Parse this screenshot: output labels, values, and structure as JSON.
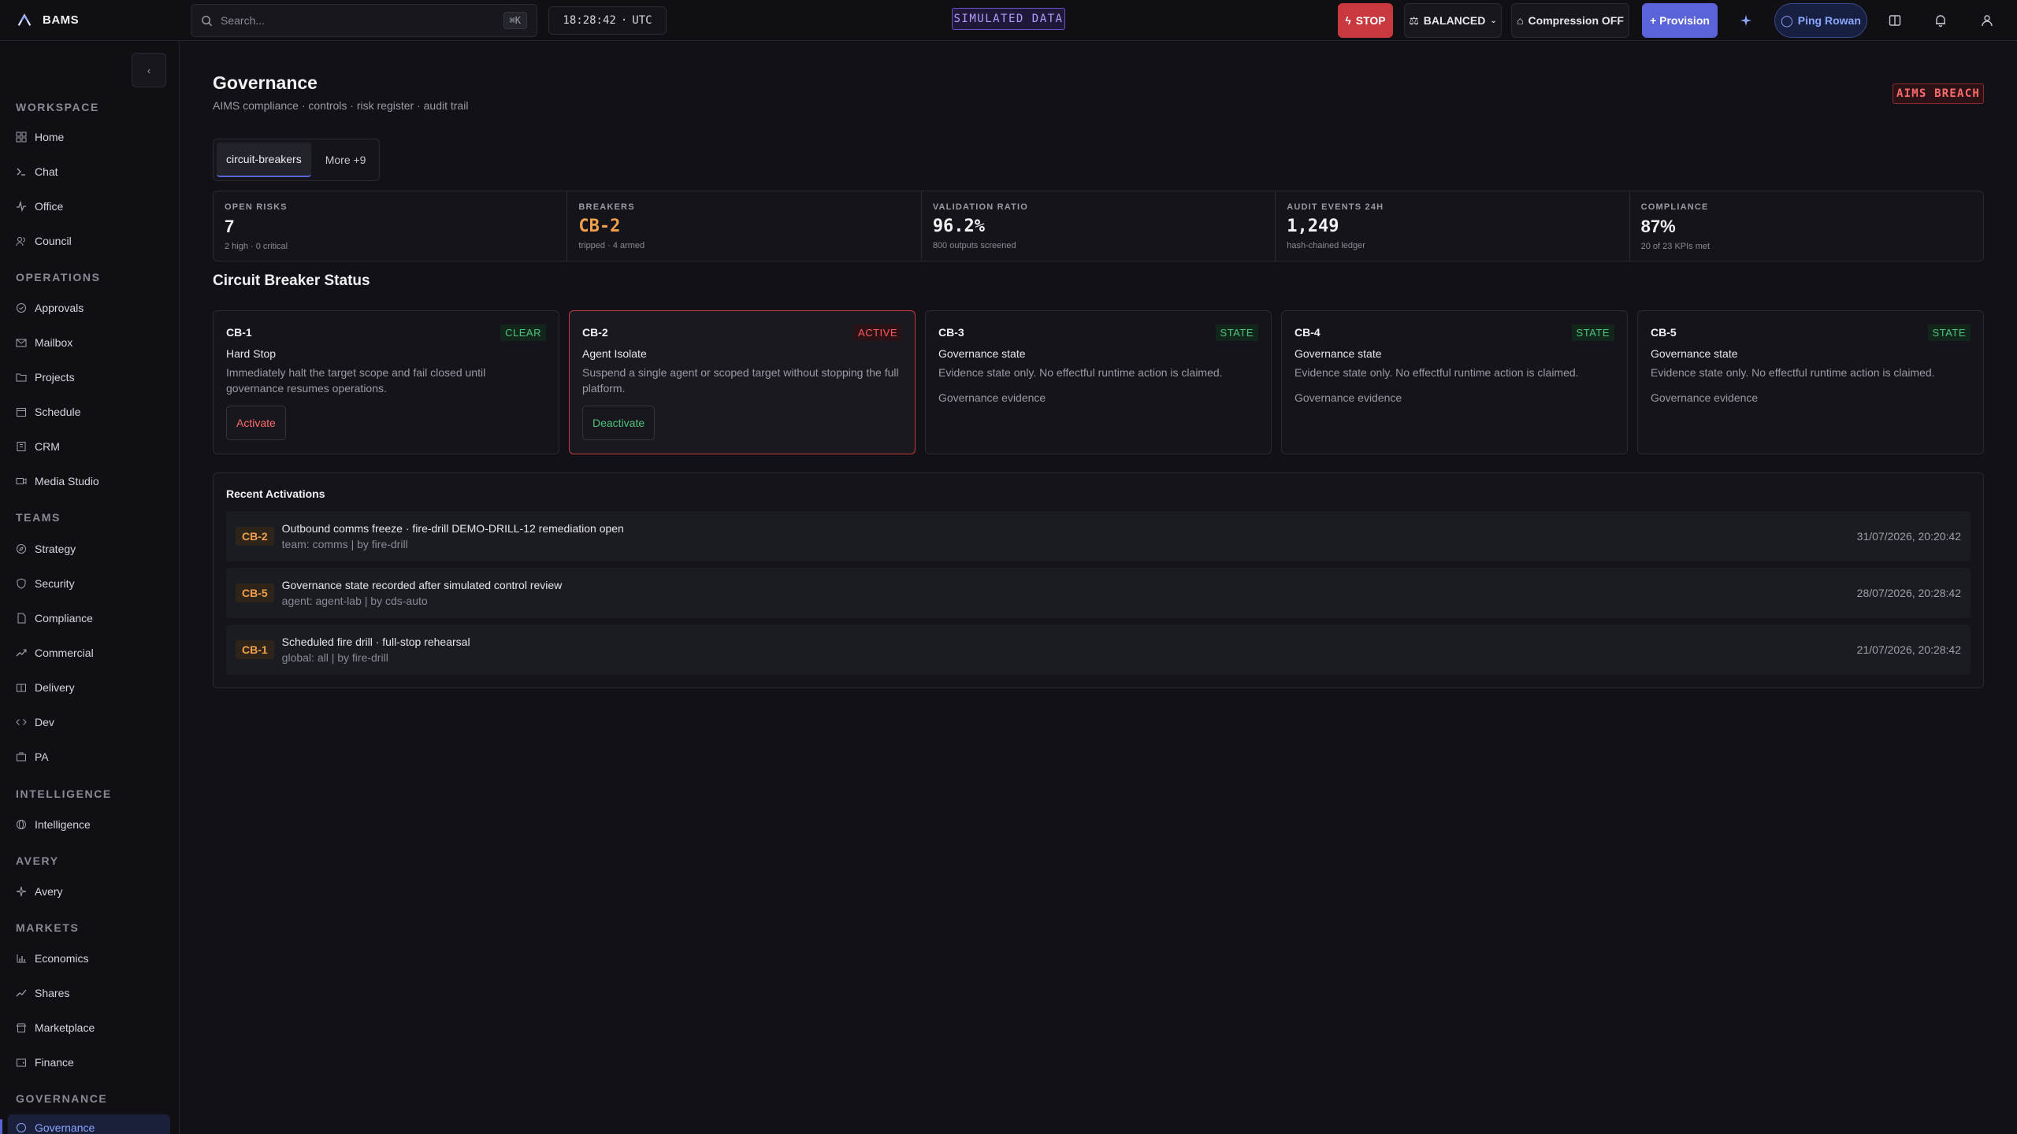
{
  "brand": {
    "name": "BAMS"
  },
  "search": {
    "placeholder": "Search...",
    "shortcut": "⌘K"
  },
  "clock": {
    "time": "18:28:42",
    "zone": "UTC"
  },
  "simulated_label": "SIMULATED DATA",
  "toolbar": {
    "stop_label": "STOP",
    "balanced_label": "BALANCED",
    "compression_label": "Compression OFF",
    "provision_label": "+ Provision",
    "ping_label": "Ping Rowan"
  },
  "sidebar": {
    "collapse_icon": "‹",
    "sections": [
      {
        "label": "WORKSPACE",
        "items": [
          "Home",
          "Chat",
          "Office",
          "Council"
        ]
      },
      {
        "label": "OPERATIONS",
        "items": [
          "Approvals",
          "Mailbox",
          "Projects",
          "Schedule",
          "CRM",
          "Media Studio"
        ]
      },
      {
        "label": "TEAMS",
        "items": [
          "Strategy",
          "Security",
          "Compliance",
          "Commercial",
          "Delivery",
          "Dev",
          "PA"
        ]
      },
      {
        "label": "INTELLIGENCE",
        "items": [
          "Intelligence"
        ]
      },
      {
        "label": "AVERY",
        "items": [
          "Avery"
        ]
      },
      {
        "label": "MARKETS",
        "items": [
          "Economics",
          "Shares",
          "Marketplace",
          "Finance"
        ]
      },
      {
        "label": "GOVERNANCE",
        "items": [
          "Governance"
        ]
      }
    ]
  },
  "page": {
    "title": "Governance",
    "subtitle": "AIMS compliance · controls · risk register · audit trail",
    "breach_badge": "AIMS BREACH"
  },
  "tabs": [
    {
      "label": "circuit-breakers",
      "active": true
    },
    {
      "label": "More +9",
      "active": false
    }
  ],
  "stats": [
    {
      "label": "OPEN RISKS",
      "value": "7",
      "note": "2 high · 0 critical"
    },
    {
      "label": "BREAKERS",
      "value": "CB-2",
      "note": "tripped · 4 armed"
    },
    {
      "label": "VALIDATION RATIO",
      "value": "96.2%",
      "note": "800 outputs screened"
    },
    {
      "label": "AUDIT EVENTS 24H",
      "value": "1,249",
      "note": "hash-chained ledger"
    },
    {
      "label": "COMPLIANCE",
      "value": "87%",
      "note": "20 of 23 KPIs met"
    }
  ],
  "breakers_title": "Circuit Breaker Status",
  "breakers": [
    {
      "id": "CB-1",
      "status": "CLEAR",
      "name": "Hard Stop",
      "desc": "Immediately halt the target scope and fail closed until governance resumes operations.",
      "action": "Activate"
    },
    {
      "id": "CB-2",
      "status": "ACTIVE",
      "name": "Agent Isolate",
      "desc": "Suspend a single agent or scoped target without stopping the full platform.",
      "action": "Deactivate"
    },
    {
      "id": "CB-3",
      "status": "STATE",
      "name": "Governance state",
      "desc": "Evidence state only. No effectful runtime action is claimed.",
      "evidence": "Governance evidence"
    },
    {
      "id": "CB-4",
      "status": "STATE",
      "name": "Governance state",
      "desc": "Evidence state only. No effectful runtime action is claimed.",
      "evidence": "Governance evidence"
    },
    {
      "id": "CB-5",
      "status": "STATE",
      "name": "Governance state",
      "desc": "Evidence state only. No effectful runtime action is claimed.",
      "evidence": "Governance evidence"
    }
  ],
  "recent": {
    "title": "Recent Activations",
    "rows": [
      {
        "badge": "CB-2",
        "title": "Outbound comms freeze · fire-drill DEMO-DRILL-12 remediation open",
        "sub": "team: comms | by fire-drill",
        "time": "31/07/2026, 20:20:42"
      },
      {
        "badge": "CB-5",
        "title": "Governance state recorded after simulated control review",
        "sub": "agent: agent-lab | by cds-auto",
        "time": "28/07/2026, 20:28:42"
      },
      {
        "badge": "CB-1",
        "title": "Scheduled fire drill · full-stop rehearsal",
        "sub": "global: all | by fire-drill",
        "time": "21/07/2026, 20:28:42"
      }
    ]
  }
}
